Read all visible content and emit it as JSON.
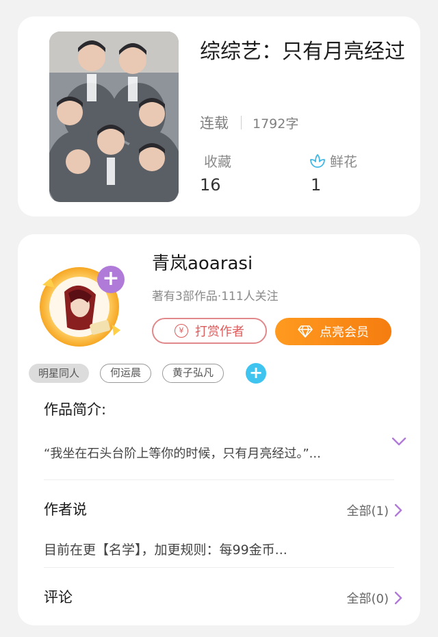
{
  "book": {
    "title": "综综艺：只有月亮经过",
    "status": "连载",
    "word_count": "1792字",
    "favorites_label": "收藏",
    "favorites_value": "16",
    "flowers_label": "鲜花",
    "flowers_value": "1"
  },
  "author": {
    "name": "青岚aoarasi",
    "meta": "著有3部作品·111人关注",
    "reward_label": "打赏作者",
    "reward_icon_glyph": "¥",
    "vip_label": "点亮会员"
  },
  "tags": [
    "明星同人",
    "何运晨",
    "黄子弘凡"
  ],
  "intro": {
    "title": "作品简介:",
    "text": "“我坐在石头台阶上等你的时候，只有月亮经过。”..."
  },
  "author_say": {
    "title": "作者说",
    "more": "全部(1)",
    "text": "目前在更【名学】，加更规则：每99金币..."
  },
  "comments": {
    "title": "评论",
    "more": "全部(0)"
  },
  "colors": {
    "accent_purple": "#b07ad8",
    "reward_red": "#dd5a5a",
    "vip_orange": "#f57d10",
    "tag_add_blue": "#3fc4ef"
  }
}
